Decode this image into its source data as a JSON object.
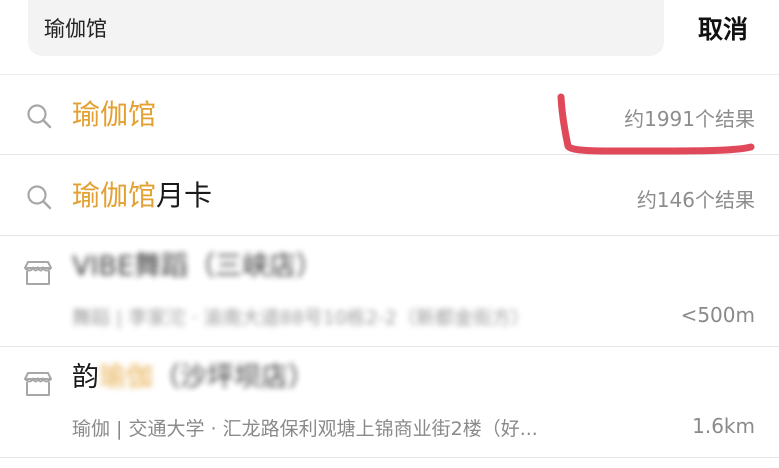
{
  "search": {
    "query": "瑜伽馆",
    "cancel_label": "取消"
  },
  "suggestions": [
    {
      "highlight": "瑜伽馆",
      "rest": "",
      "count": "约1991个结果",
      "icon": "search-icon"
    },
    {
      "highlight": "瑜伽馆",
      "rest": "月卡",
      "count": "约146个结果",
      "icon": "search-icon"
    }
  ],
  "places": [
    {
      "title": "VIBE舞蹈（三峡店）",
      "subtitle": "舞蹈 | 李家沱 · 渝南大道88号10栋2-2（新都金街方）",
      "distance": "<500m",
      "icon": "store-icon"
    },
    {
      "title_prefix": "韵",
      "title_highlight": "瑜伽",
      "title_rest": "（沙坪坝店）",
      "subtitle": "瑜伽 | 交通大学 · 汇龙路保利观塘上锦商业街2楼（好...",
      "distance": "1.6km",
      "icon": "store-icon"
    }
  ],
  "colors": {
    "highlight": "#e3a133",
    "annotation": "#e0495a"
  }
}
